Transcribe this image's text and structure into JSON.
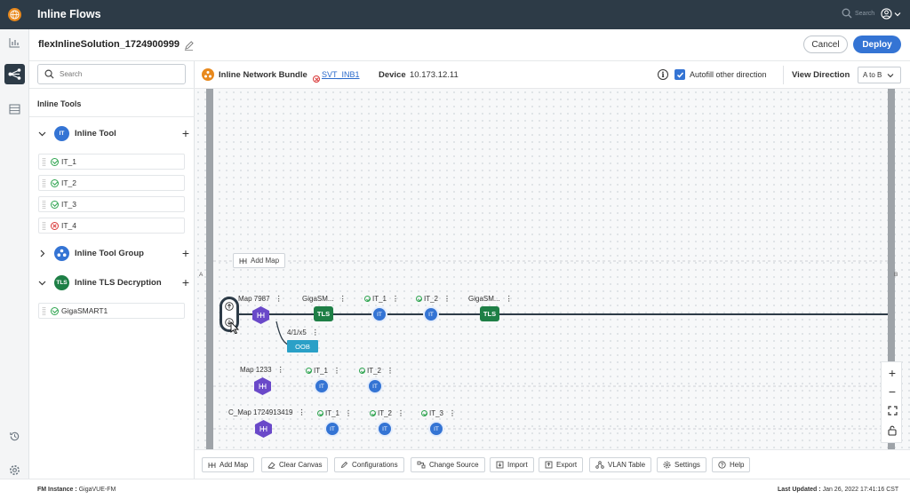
{
  "app": {
    "title": "Inline Flows",
    "search_label": "Search"
  },
  "flow": {
    "name": "flexInlineSolution_1724900999",
    "cancel_label": "Cancel",
    "deploy_label": "Deploy"
  },
  "search": {
    "placeholder": "Search"
  },
  "inline_tools": {
    "heading": "Inline Tools",
    "categories": [
      {
        "label": "Inline Tool",
        "badge": "IT",
        "color": "#3474d4"
      },
      {
        "label": "Inline Tool Group",
        "badge": "",
        "color": "#3474d4"
      },
      {
        "label": "Inline TLS Decryption",
        "badge": "TLS",
        "color": "#1e7f46"
      }
    ],
    "tools": [
      {
        "label": "IT_1",
        "status": "ok"
      },
      {
        "label": "IT_2",
        "status": "ok"
      },
      {
        "label": "IT_3",
        "status": "ok"
      },
      {
        "label": "IT_4",
        "status": "error"
      }
    ],
    "tls_tools": [
      {
        "label": "GigaSMART1",
        "status": "ok"
      }
    ]
  },
  "bundle": {
    "label": "Inline Network Bundle",
    "name": "SVT_INB1",
    "device_label": "Device",
    "device_ip": "10.173.12.11",
    "autofill_label": "Autofill other direction",
    "autofill_checked": true,
    "view_direction_label": "View Direction",
    "view_direction_value": "A to B"
  },
  "canvas": {
    "side_a": "A",
    "side_b": "B",
    "add_map_label": "Add Map",
    "primary_flow": {
      "map": "Map 7987",
      "port": "4/1/x5",
      "oob": "OOB",
      "nodes": [
        {
          "label": "GigaSM...",
          "type": "TLS"
        },
        {
          "label": "IT_1",
          "type": "IT"
        },
        {
          "label": "IT_2",
          "type": "IT"
        },
        {
          "label": "GigaSM...",
          "type": "TLS"
        }
      ]
    },
    "flow2": {
      "map": "Map 1233",
      "nodes": [
        {
          "label": "IT_1",
          "type": "IT"
        },
        {
          "label": "IT_2",
          "type": "IT"
        }
      ]
    },
    "flow3": {
      "map": "C_Map 1724913419",
      "nodes": [
        {
          "label": "IT_1",
          "type": "IT"
        },
        {
          "label": "IT_2",
          "type": "IT"
        },
        {
          "label": "IT_3",
          "type": "IT"
        }
      ]
    }
  },
  "toolbar": {
    "add_map": "Add Map",
    "clear_canvas": "Clear Canvas",
    "configurations": "Configurations",
    "change_source": "Change Source",
    "import": "Import",
    "export": "Export",
    "vlan_table": "VLAN Table",
    "settings": "Settings",
    "help": "Help"
  },
  "footer": {
    "instance_label": "FM Instance :",
    "instance_value": "GigaVUE-FM",
    "updated_label": "Last Updated :",
    "updated_value": "Jan 26, 2022 17:41:16 CST"
  },
  "colors": {
    "topbar": "#2d3b47",
    "primary": "#3474d4",
    "tls": "#1e7f46",
    "map": "#6a49c9",
    "oob": "#2aa0c7",
    "bundle_icon": "#e8891d"
  }
}
